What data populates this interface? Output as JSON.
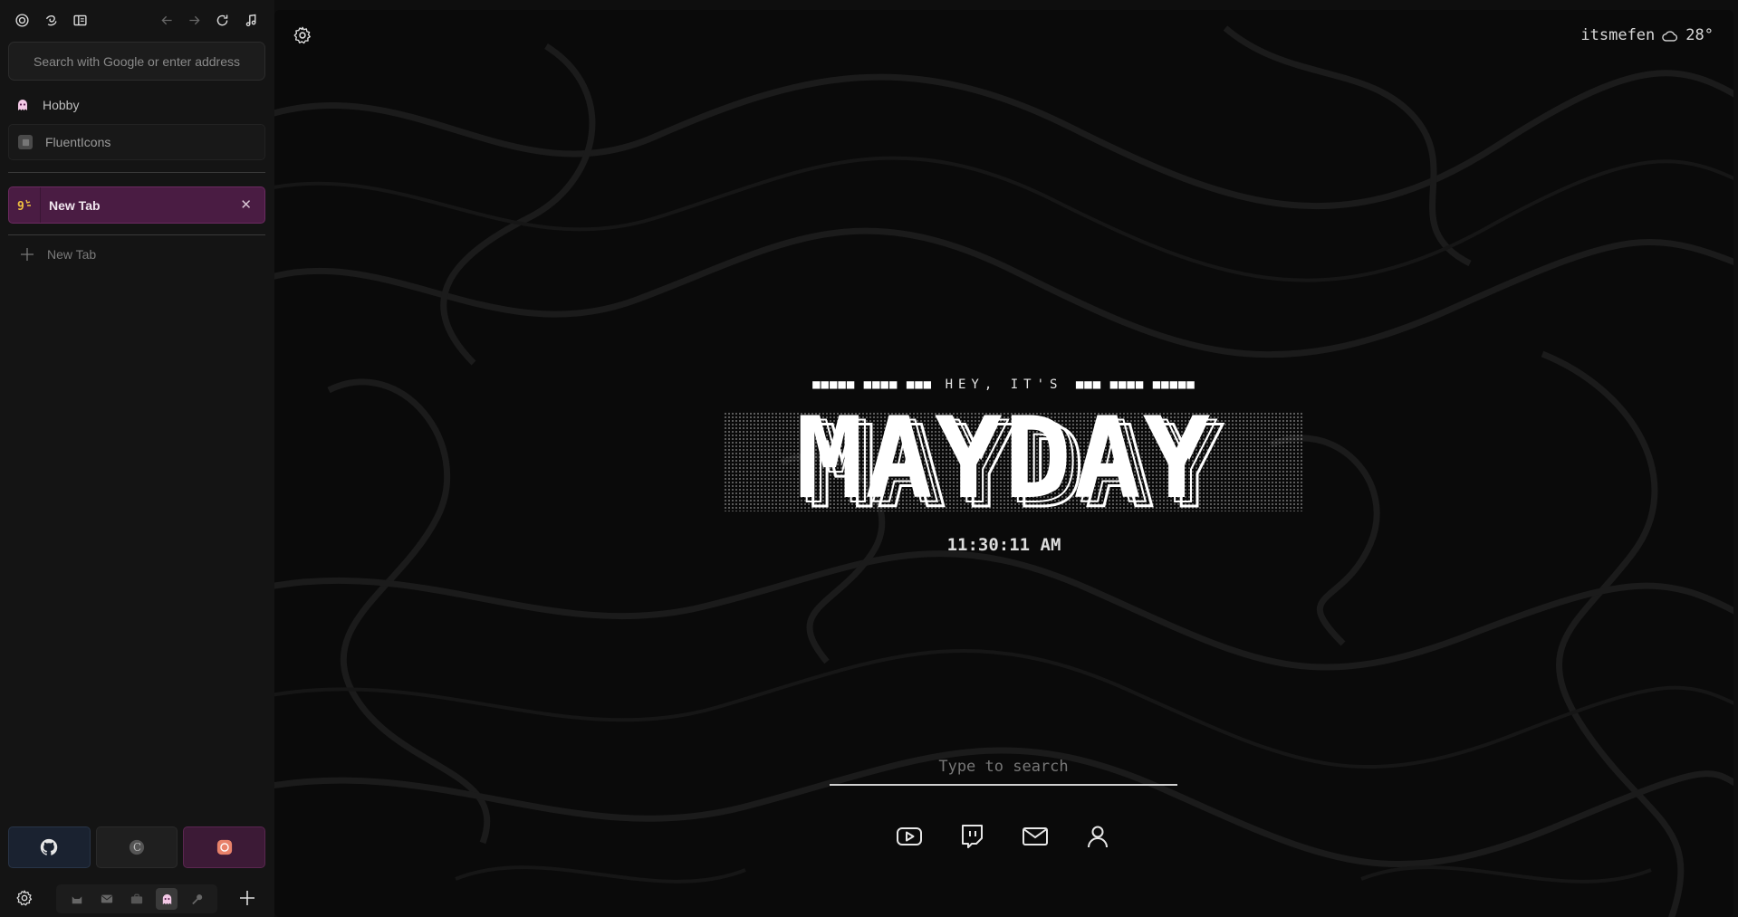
{
  "sidebar": {
    "url_placeholder": "Search with Google or enter address",
    "folder": {
      "label": "Hobby",
      "icon": "ghost-icon"
    },
    "pinned_tabs": [
      {
        "label": "FluentIcons",
        "icon": "fluenticons-favicon"
      }
    ],
    "tabs": [
      {
        "label": "New Tab",
        "active": true,
        "icon": "new-tab-favicon",
        "close_label": "✕"
      }
    ],
    "new_tab_label": "New Tab",
    "essentials": [
      {
        "name": "github",
        "icon": "github-icon"
      },
      {
        "name": "c-site",
        "icon": "c-letter-icon"
      },
      {
        "name": "pink-site",
        "icon": "pink-circle-icon"
      }
    ],
    "spaces": [
      "cat-icon",
      "mail-icon",
      "briefcase-icon",
      "ghost-icon",
      "wrench-icon"
    ],
    "active_space": 3
  },
  "main": {
    "weather": {
      "user": "itsmefen",
      "temperature": "28°",
      "icon": "cloud-icon"
    },
    "greeting": {
      "blocks_left": "■■■■■ ■■■■ ■■■",
      "text": "HEY, IT'S",
      "blocks_right": "■■■ ■■■■ ■■■■■"
    },
    "logo_text": "MAYDAY",
    "clock": "11:30:11 AM",
    "search": {
      "placeholder": "Type to search"
    },
    "quick_links": [
      "youtube-icon",
      "twitch-icon",
      "mail-icon",
      "profile-icon"
    ]
  },
  "colors": {
    "sidebar_bg": "#141414",
    "active_tab_bg": "#4a1c43",
    "main_bg": "#0a0a0a"
  }
}
